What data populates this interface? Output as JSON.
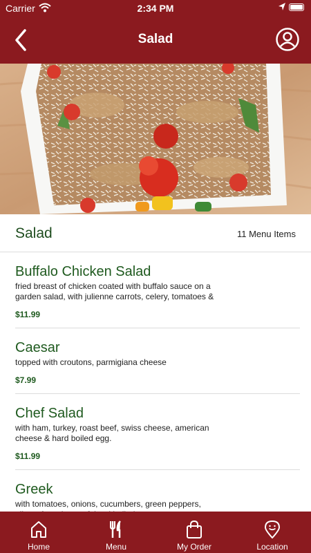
{
  "status_bar": {
    "carrier": "Carrier",
    "time": "2:34 PM"
  },
  "header": {
    "title": "Salad"
  },
  "section": {
    "title": "Salad",
    "count_label": "11 Menu Items"
  },
  "items": [
    {
      "name": "Buffalo Chicken Salad",
      "description": "fried breast of chicken coated with buffalo sauce on a garden salad, with julienne carrots, celery, tomatoes &",
      "price": "$11.99"
    },
    {
      "name": "Caesar",
      "description": "topped with croutons, parmigiana cheese",
      "price": "$7.99"
    },
    {
      "name": "Chef Salad",
      "description": "with ham, turkey, roast beef, swiss cheese, american cheese & hard boiled egg.",
      "price": "$11.99"
    },
    {
      "name": "Greek",
      "description": "with tomatoes, onions, cucumbers, green peppers, olives, feta cheese & hard boiled egg.",
      "price": ""
    }
  ],
  "tabs": [
    {
      "label": "Home",
      "icon": "home-icon"
    },
    {
      "label": "Menu",
      "icon": "fork-knife-icon"
    },
    {
      "label": "My Order",
      "icon": "shopping-bag-icon"
    },
    {
      "label": "Location",
      "icon": "location-pin-icon"
    }
  ],
  "colors": {
    "brand": "#8b1a1f",
    "item_text": "#1f5a1f",
    "divider": "#dcdcdc"
  }
}
